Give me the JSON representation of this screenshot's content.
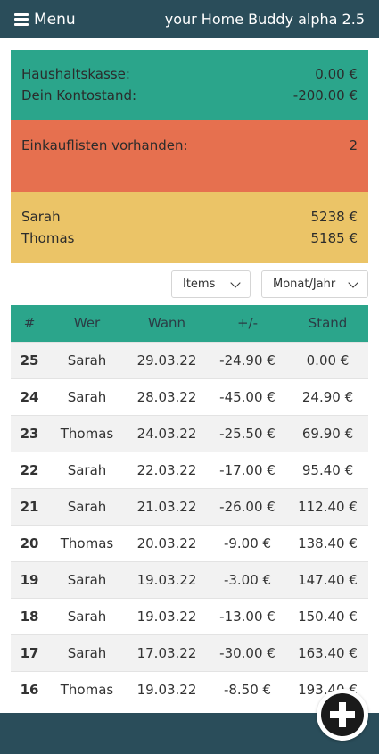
{
  "header": {
    "menu_label": "Menu",
    "app_title": "your Home Buddy alpha 2.5"
  },
  "balance_card": {
    "rows": [
      {
        "label": "Haushaltskasse:",
        "value": "0.00 €"
      },
      {
        "label": "Dein Kontostand:",
        "value": "-200.00 €"
      }
    ]
  },
  "shopping_card": {
    "label": "Einkauflisten vorhanden:",
    "value": "2"
  },
  "members_card": {
    "rows": [
      {
        "label": "Sarah",
        "value": "5238 €"
      },
      {
        "label": "Thomas",
        "value": "5185 €"
      }
    ]
  },
  "filters": {
    "items_label": "Items",
    "period_label": "Monat/Jahr"
  },
  "table": {
    "headers": [
      "#",
      "Wer",
      "Wann",
      "+/-",
      "Stand"
    ],
    "rows": [
      [
        "25",
        "Sarah",
        "29.03.22",
        "-24.90 €",
        "0.00 €"
      ],
      [
        "24",
        "Sarah",
        "28.03.22",
        "-45.00 €",
        "24.90 €"
      ],
      [
        "23",
        "Thomas",
        "24.03.22",
        "-25.50 €",
        "69.90 €"
      ],
      [
        "22",
        "Sarah",
        "22.03.22",
        "-17.00 €",
        "95.40 €"
      ],
      [
        "21",
        "Sarah",
        "21.03.22",
        "-26.00 €",
        "112.40 €"
      ],
      [
        "20",
        "Thomas",
        "20.03.22",
        "-9.00 €",
        "138.40 €"
      ],
      [
        "19",
        "Sarah",
        "19.03.22",
        "-3.00 €",
        "147.40 €"
      ],
      [
        "18",
        "Sarah",
        "19.03.22",
        "-13.00 €",
        "150.40 €"
      ],
      [
        "17",
        "Sarah",
        "17.03.22",
        "-30.00 €",
        "163.40 €"
      ],
      [
        "16",
        "Thomas",
        "19.03.22",
        "-8.50 €",
        "193.40 €"
      ]
    ]
  },
  "colors": {
    "header_bg": "#2a4d5a",
    "teal": "#2ba58b",
    "orange": "#e6704f",
    "yellow": "#ebc467"
  },
  "icons": {
    "menu": "hamburger-icon",
    "fab": "plus-circle-icon",
    "select": "chevron-down-icon"
  }
}
